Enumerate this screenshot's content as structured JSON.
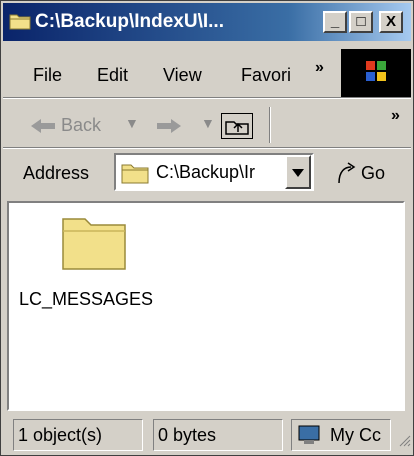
{
  "window": {
    "title": "C:\\Backup\\IndexU\\I..."
  },
  "title_buttons": {
    "minimize": "_",
    "maximize": "□",
    "close": "X"
  },
  "menu": {
    "items": [
      "File",
      "Edit",
      "View",
      "Favori"
    ],
    "more": "»"
  },
  "toolbar": {
    "back_label": "Back",
    "more": "»"
  },
  "address": {
    "label": "Address",
    "value": "C:\\Backup\\Ir",
    "go_label": "Go"
  },
  "content": {
    "items": [
      {
        "name": "LC_MESSAGES",
        "icon": "folder-icon"
      }
    ]
  },
  "status": {
    "objects": "1 object(s)",
    "size": "0 bytes",
    "zone": "My Cc"
  },
  "colors": {
    "title_dark": "#0a246a",
    "title_light": "#a6caf0",
    "chrome": "#d4d0c8",
    "folder": "#f2e08a"
  }
}
